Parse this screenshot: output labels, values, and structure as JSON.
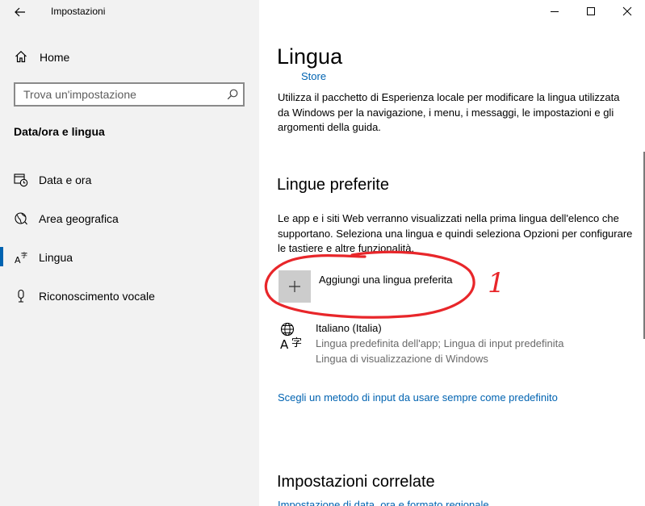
{
  "window": {
    "app_title": "Impostazioni"
  },
  "sidebar": {
    "home_label": "Home",
    "search_placeholder": "Trova un'impostazione",
    "section_title": "Data/ora e lingua",
    "items": [
      {
        "label": "Data e ora",
        "icon": "calendar-clock-icon"
      },
      {
        "label": "Area geografica",
        "icon": "globe-icon"
      },
      {
        "label": "Lingua",
        "icon": "language-icon",
        "selected": true
      },
      {
        "label": "Riconoscimento vocale",
        "icon": "microphone-icon"
      }
    ]
  },
  "main": {
    "title": "Lingua",
    "store_link": "Store",
    "intro_text": "Utilizza il pacchetto di Esperienza locale per modificare la lingua utilizzata da Windows per la navigazione, i menu, i messaggi, le impostazioni e gli argomenti della guida.",
    "preferred_heading": "Lingue preferite",
    "preferred_text": "Le app e i siti Web verranno visualizzati nella prima lingua dell'elenco che supportano. Seleziona una lingua e quindi seleziona Opzioni per configurare le tastiere e altre funzionalità.",
    "add_language_label": "Aggiungi una lingua preferita",
    "languages": [
      {
        "name": "Italiano (Italia)",
        "detail_1": "Lingua predefinita dell'app; Lingua di input predefinita",
        "detail_2": "Lingua di visualizzazione di Windows"
      }
    ],
    "input_method_link": "Scegli un metodo di input da usare sempre come predefinito",
    "related_heading": "Impostazioni correlate",
    "related_link": "Impostazione di data, ora e formato regionale"
  },
  "annotation": {
    "color": "#e8262a",
    "marker_text": "1"
  }
}
